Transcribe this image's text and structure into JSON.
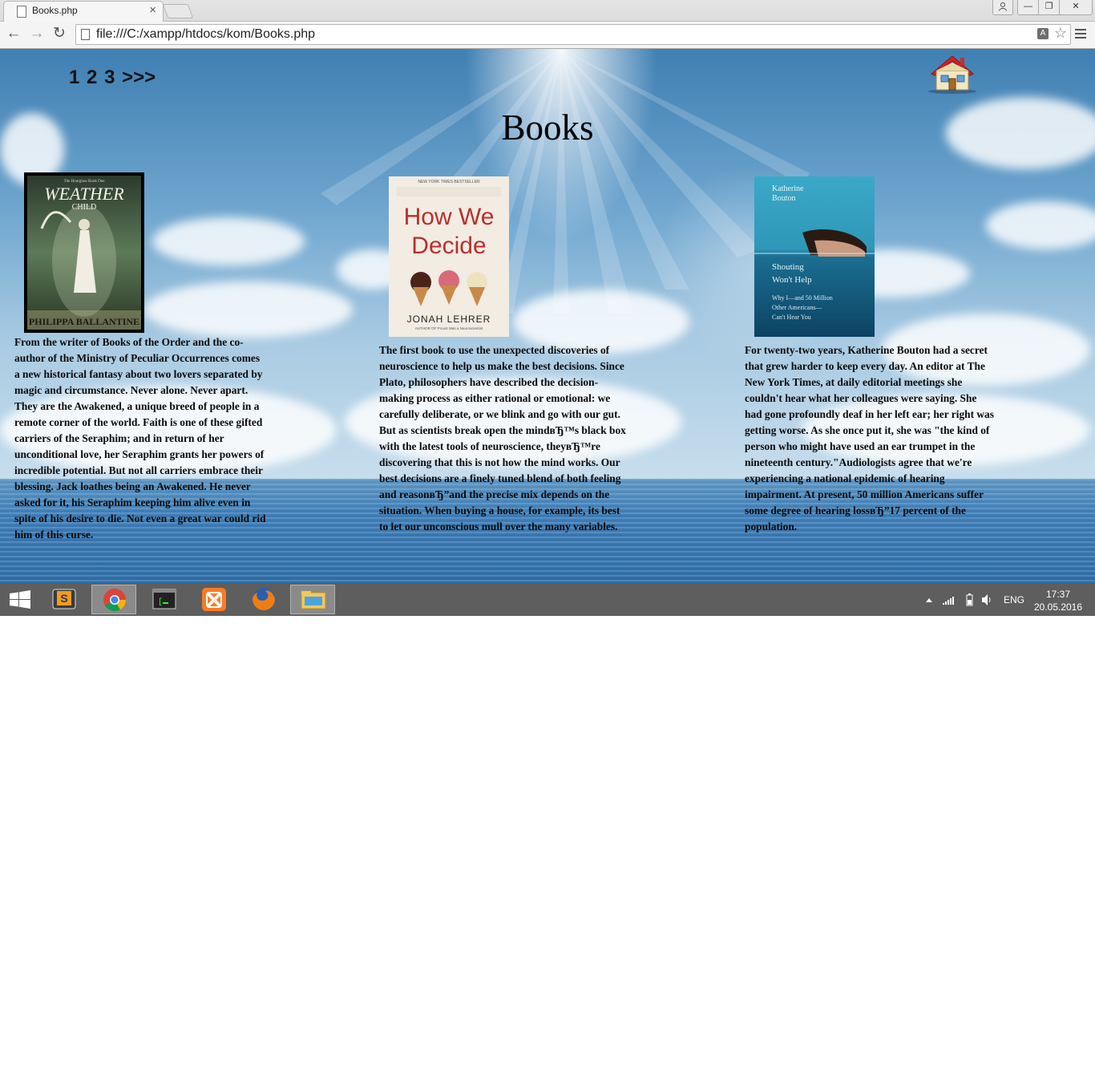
{
  "browser": {
    "tab_title": "Books.php",
    "tab_close": "×",
    "url": "file:///C:/xampp/htdocs/kom/Books.php",
    "window_controls": {
      "minimize": "—",
      "maximize": "❐",
      "close": "✕"
    },
    "nav": {
      "back": "←",
      "forward": "→",
      "reload": "↻"
    },
    "omnibox_icons": [
      "translate-icon",
      "star-icon"
    ]
  },
  "page": {
    "pager": [
      "1",
      "2",
      "3",
      ">>>"
    ],
    "title": "Books",
    "books": [
      {
        "cover": {
          "series": "The Hourglass Book One",
          "title_line1": "WEATHER",
          "title_line2": "CHILD",
          "author": "PHILIPPA BALLANTINE",
          "border_color": "#000000"
        },
        "description": "From the writer of Books of the Order and the co-author of the Ministry of Peculiar Occurrences comes a new historical fantasy about two lovers separated by magic and circumstance. Never alone. Never apart. They are the Awakened, a unique breed of people in a remote corner of the world. Faith is one of these gifted carriers of the Seraphim; and in return of her unconditional love, her Seraphim grants her powers of incredible potential. But not all carriers embrace their blessing. Jack loathes being an Awakened. He never asked for it, his Seraphim keeping him alive even in spite of his desire to die. Not even a great war could rid him of this curse."
      },
      {
        "cover": {
          "banner": "NEW YORK TIMES BESTSELLER",
          "title_line1": "How We",
          "title_line2": "Decide",
          "author": "JONAH LEHRER",
          "subtitle": "AUTHOR OF Proust Was a Neuroscientist"
        },
        "description": "The first book to use the unexpected discoveries of neuroscience to help us make the best decisions. Since Plato, philosophers have described the decision-making process as either rational or emotional: we carefully deliberate, or we blink and go with our gut. But as scientists break open the mindвЂ™s black box with the latest tools of neuroscience, theyвЂ™re discovering that this is not how the mind works. Our best decisions are a finely tuned blend of both feeling and reasonвЂ”and the precise mix depends on the situation. When buying a house, for example, its best to let our unconscious mull over the many variables."
      },
      {
        "cover": {
          "author_line1": "Katherine",
          "author_line2": "Bouton",
          "title_line1": "Shouting",
          "title_line2": "Won't Help",
          "subtitle_line1": "Why I—and 50 Million",
          "subtitle_line2": "Other Americans—",
          "subtitle_line3": "Can't Hear You"
        },
        "description": "For twenty-two years, Katherine Bouton had a secret that grew harder to keep every day. An editor at The New York Times, at daily editorial meetings she couldn't hear what her colleagues were saying. She had gone profoundly deaf in her left ear; her right was getting worse. As she once put it, she was \"the kind of person who might have used an ear trumpet in the nineteenth century.\"Audiologists agree that we're experiencing a national epidemic of hearing impairment. At present, 50 million Americans suffer some degree of hearing lossвЂ”17 percent of the population."
      }
    ]
  },
  "taskbar": {
    "apps": [
      "windows-start-icon",
      "sublime-text-icon",
      "chrome-icon",
      "terminal-icon",
      "xampp-icon",
      "firefox-icon",
      "file-explorer-icon"
    ],
    "tray": {
      "language": "ENG",
      "time": "17:37",
      "date": "20.05.2016"
    }
  }
}
